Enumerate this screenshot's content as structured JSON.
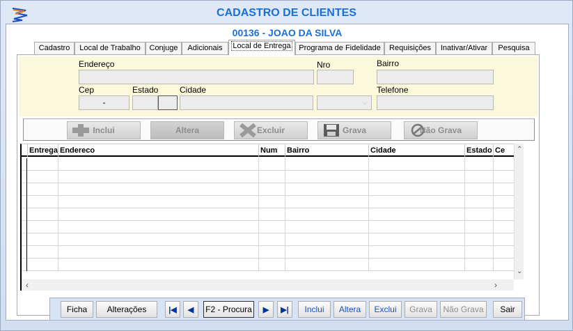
{
  "window": {
    "title": "CADASTRO DE CLIENTES",
    "client_name": "00136 - JOAO DA SILVA"
  },
  "tabs": [
    {
      "label": "Cadastro"
    },
    {
      "label": "Local de Trabalho"
    },
    {
      "label": "Conjuge"
    },
    {
      "label": "Adicionais"
    },
    {
      "label": "Local de Entrega",
      "active": true
    },
    {
      "label": "Programa de Fidelidade"
    },
    {
      "label": "Requisições"
    },
    {
      "label": "Inativar/Ativar"
    },
    {
      "label": "Pesquisa"
    }
  ],
  "form": {
    "endereco_label": "Endereço",
    "nro_label": "Nro",
    "bairro_label": "Bairro",
    "cep_label": "Cep",
    "estado_label": "Estado",
    "cidade_label": "Cidade",
    "telefone_label": "Telefone",
    "cep_value": "-"
  },
  "actions": {
    "inclui": "Inclui",
    "altera": "Altera",
    "excluir": "Excluir",
    "grava": "Grava",
    "nao_grava": "Não Grava"
  },
  "grid": {
    "columns": [
      "Entrega",
      "Endereco",
      "Num",
      "Bairro",
      "Cidade",
      "Estado",
      "Ce"
    ]
  },
  "bottom": {
    "ficha": "Ficha",
    "alteracoes": "Alterações",
    "procura": "F2 - Procura",
    "inclui": "Inclui",
    "altera": "Altera",
    "exclui": "Exclui",
    "grava": "Grava",
    "nao_grava": "Não Grava",
    "sair": "Sair"
  },
  "colors": {
    "accent": "#1a6fd6",
    "form_bg": "#fbf8dc",
    "window_bg": "#d4e0f2"
  }
}
